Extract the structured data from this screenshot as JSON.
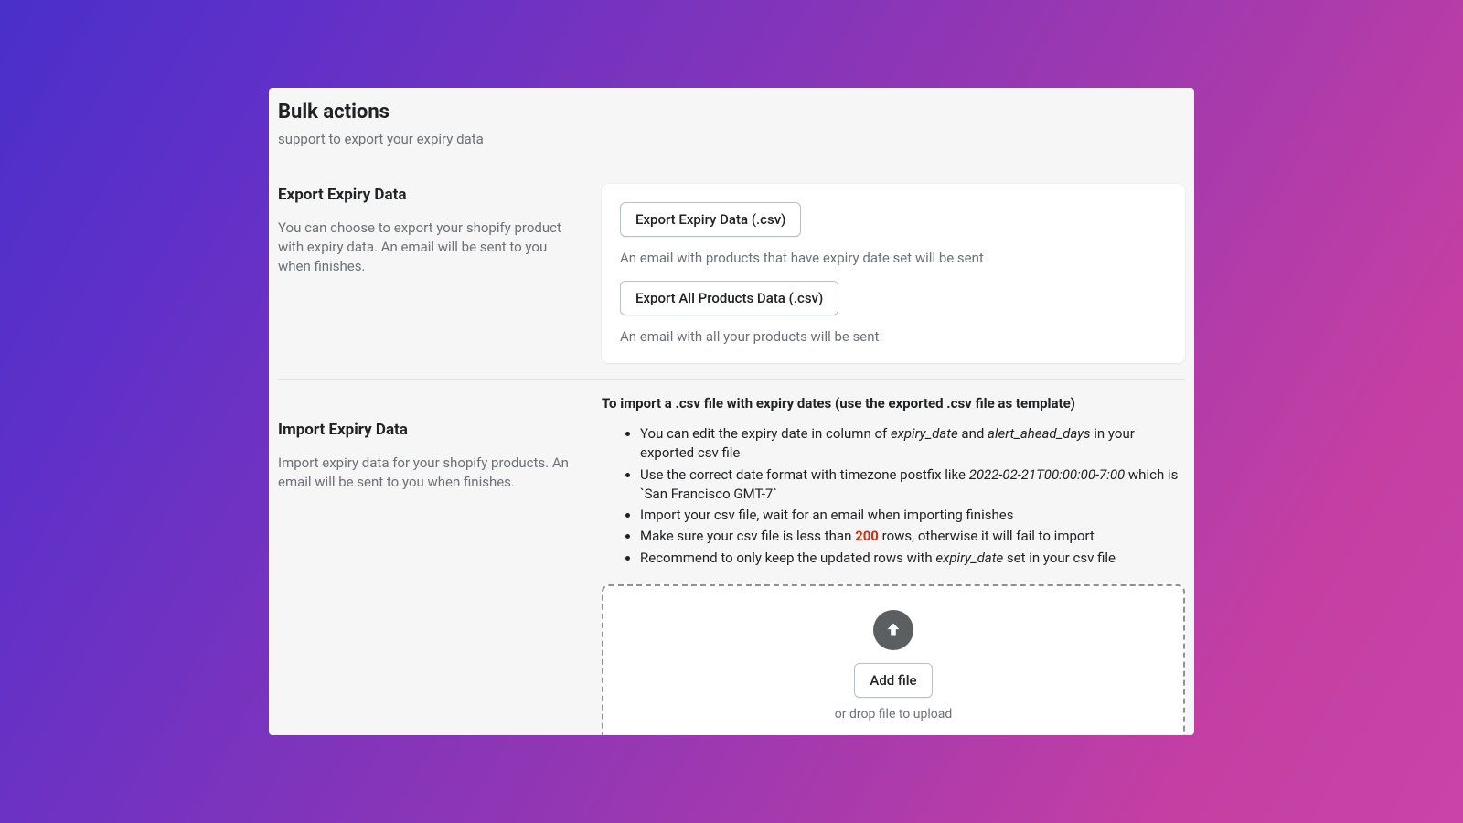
{
  "header": {
    "title": "Bulk actions",
    "subtitle": "support to export your expiry data"
  },
  "exportSection": {
    "title": "Export Expiry Data",
    "description": "You can choose to export your shopify product with expiry data. An email will be sent to you when finishes.",
    "buttons": {
      "exportExpiry": "Export Expiry Data (.csv)",
      "exportAll": "Export All Products Data (.csv)"
    },
    "helperExpiry": "An email with products that have expiry date set will be sent",
    "helperAll": "An email with all your products will be sent"
  },
  "importSection": {
    "title": "Import Expiry Data",
    "description": "Import expiry data for your shopify products. An email will be sent to you when finishes.",
    "heading": "To import a .csv file with expiry dates (use the exported .csv file as template)",
    "bullet1_pre": "You can edit the expiry date in column of ",
    "bullet1_i1": "expiry_date",
    "bullet1_mid": " and ",
    "bullet1_i2": "alert_ahead_days",
    "bullet1_post": " in your exported csv file",
    "bullet2_pre": "Use the correct date format with timezone postfix like ",
    "bullet2_i": "2022-02-21T00:00:00-7:00",
    "bullet2_post": " which is `San Francisco GMT-7`",
    "bullet3": "Import your csv file, wait for an email when importing finishes",
    "bullet4_pre": "Make sure your csv file is less than ",
    "bullet4_limit": "200",
    "bullet4_post": " rows, otherwise it will fail to import",
    "bullet5_pre": "Recommend to only keep the updated rows with ",
    "bullet5_i": "expiry_date",
    "bullet5_post": " set in your csv file",
    "addFileLabel": "Add file",
    "dropHint": "or drop file to upload"
  }
}
